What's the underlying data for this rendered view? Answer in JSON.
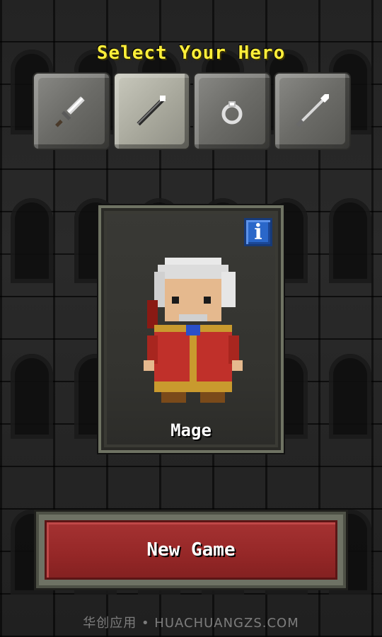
{
  "screen": {
    "title": "Select Your Hero",
    "title_color": "#ffef3a"
  },
  "hero_tabs": [
    {
      "id": "warrior",
      "icon": "sword-icon",
      "selected": false
    },
    {
      "id": "mage",
      "icon": "staff-icon",
      "selected": true
    },
    {
      "id": "rogue",
      "icon": "ring-icon",
      "selected": false
    },
    {
      "id": "huntress",
      "icon": "spear-icon",
      "selected": false
    }
  ],
  "hero_card": {
    "name": "Mage",
    "info_label": "i",
    "info_color": "#2a67c9",
    "robe_color": "#c0302a"
  },
  "actions": {
    "new_game_label": "New Game",
    "new_game_color": "#9b2a2a"
  },
  "watermark": {
    "text": "华创应用 • HUACHUANGZS.COM"
  }
}
